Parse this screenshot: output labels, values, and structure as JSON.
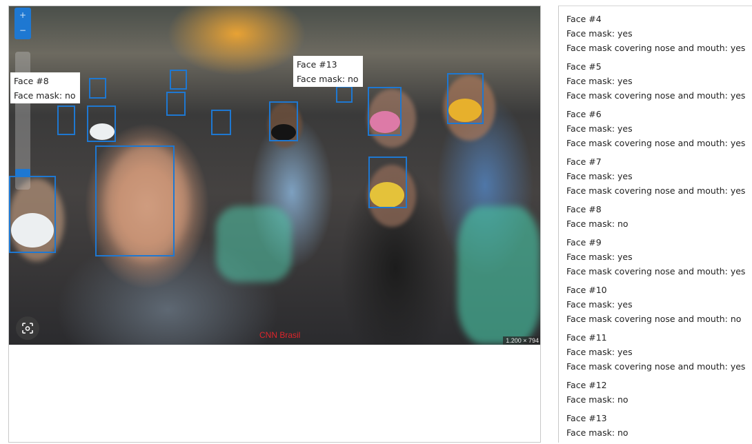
{
  "image": {
    "credit": "CNN Brasil",
    "dimensions_badge": "1.200 × 794"
  },
  "zoom": {
    "plus": "+",
    "minus": "−"
  },
  "labels": [
    {
      "face": "Face #8",
      "mask": "Face mask: no"
    },
    {
      "face": "Face #13",
      "mask": "Face mask: no"
    }
  ],
  "faces": [
    {
      "title": "Face #4",
      "mask": "Face mask: yes",
      "cover": "Face mask covering nose and mouth: yes"
    },
    {
      "title": "Face #5",
      "mask": "Face mask: yes",
      "cover": "Face mask covering nose and mouth: yes"
    },
    {
      "title": "Face #6",
      "mask": "Face mask: yes",
      "cover": "Face mask covering nose and mouth: yes"
    },
    {
      "title": "Face #7",
      "mask": "Face mask: yes",
      "cover": "Face mask covering nose and mouth: yes"
    },
    {
      "title": "Face #8",
      "mask": "Face mask: no"
    },
    {
      "title": "Face #9",
      "mask": "Face mask: yes",
      "cover": "Face mask covering nose and mouth: yes"
    },
    {
      "title": "Face #10",
      "mask": "Face mask: yes",
      "cover": "Face mask covering nose and mouth: no"
    },
    {
      "title": "Face #11",
      "mask": "Face mask: yes",
      "cover": "Face mask covering nose and mouth: yes"
    },
    {
      "title": "Face #12",
      "mask": "Face mask: no"
    },
    {
      "title": "Face #13",
      "mask": "Face mask: no"
    }
  ]
}
